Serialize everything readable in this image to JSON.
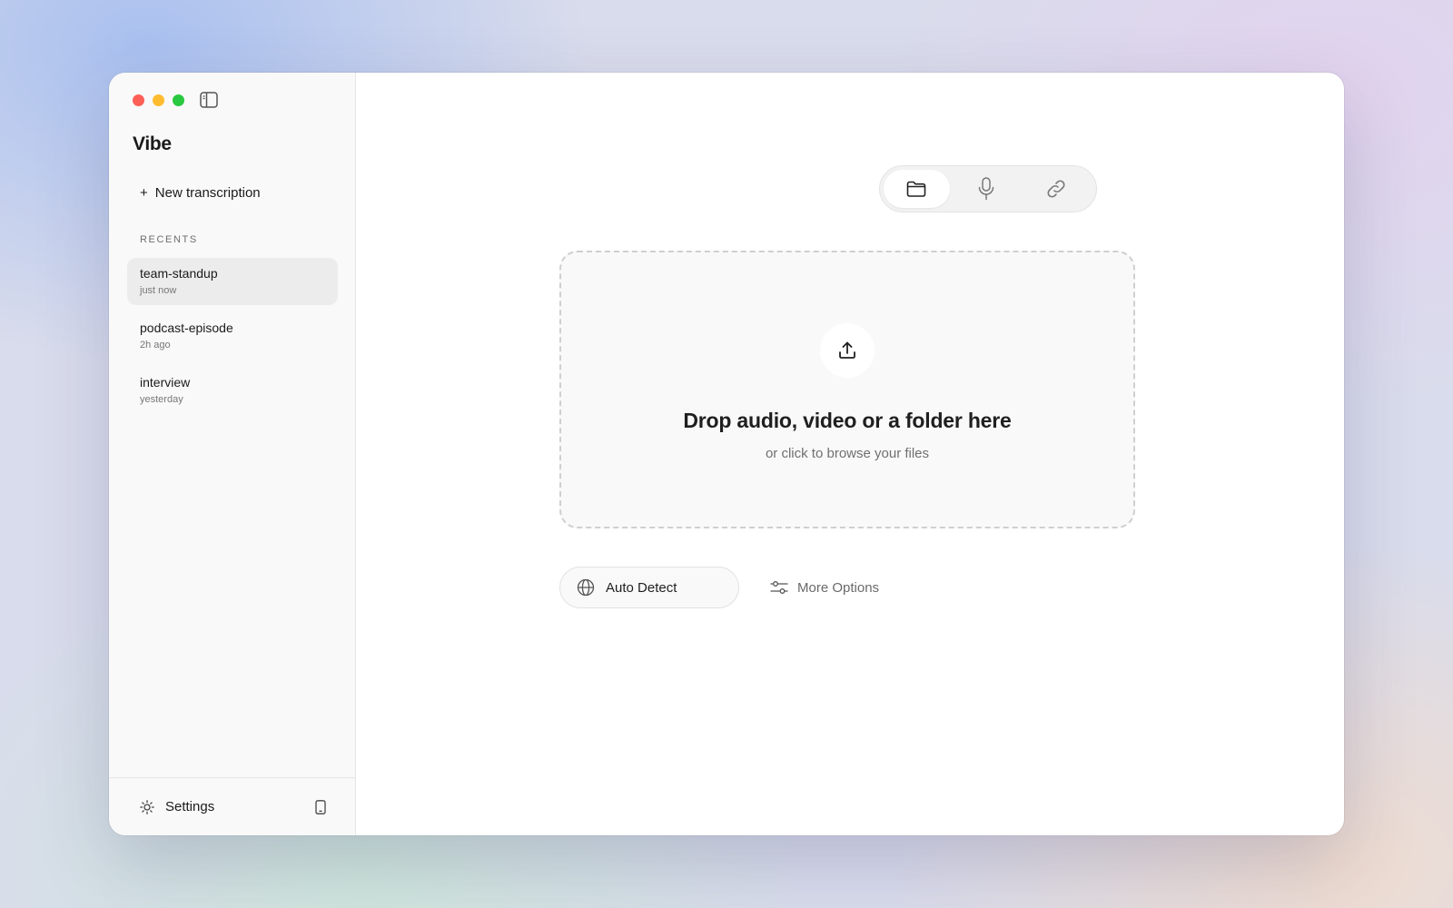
{
  "app": {
    "title": "Vibe"
  },
  "sidebar": {
    "new_label": "New transcription",
    "new_plus": "+",
    "recents_label": "RECENTS",
    "recents": [
      {
        "name": "team-standup",
        "time": "just now",
        "active": true
      },
      {
        "name": "podcast-episode",
        "time": "2h ago",
        "active": false
      },
      {
        "name": "interview",
        "time": "yesterday",
        "active": false
      }
    ],
    "settings_label": "Settings"
  },
  "main": {
    "modes": [
      {
        "icon": "folder-icon",
        "active": true
      },
      {
        "icon": "microphone-icon",
        "active": false
      },
      {
        "icon": "link-icon",
        "active": false
      }
    ],
    "dropzone": {
      "title": "Drop audio, video or a folder here",
      "subtitle": "or click to browse your files",
      "icon": "upload-icon"
    },
    "language": {
      "value": "Auto Detect",
      "icon": "globe-icon"
    },
    "more_options": {
      "label": "More Options",
      "icon": "sliders-icon"
    }
  },
  "colors": {
    "close": "#fe5f57",
    "minimize": "#febc2e",
    "maximize": "#28c840",
    "accent_text": "#1a1a1a"
  }
}
